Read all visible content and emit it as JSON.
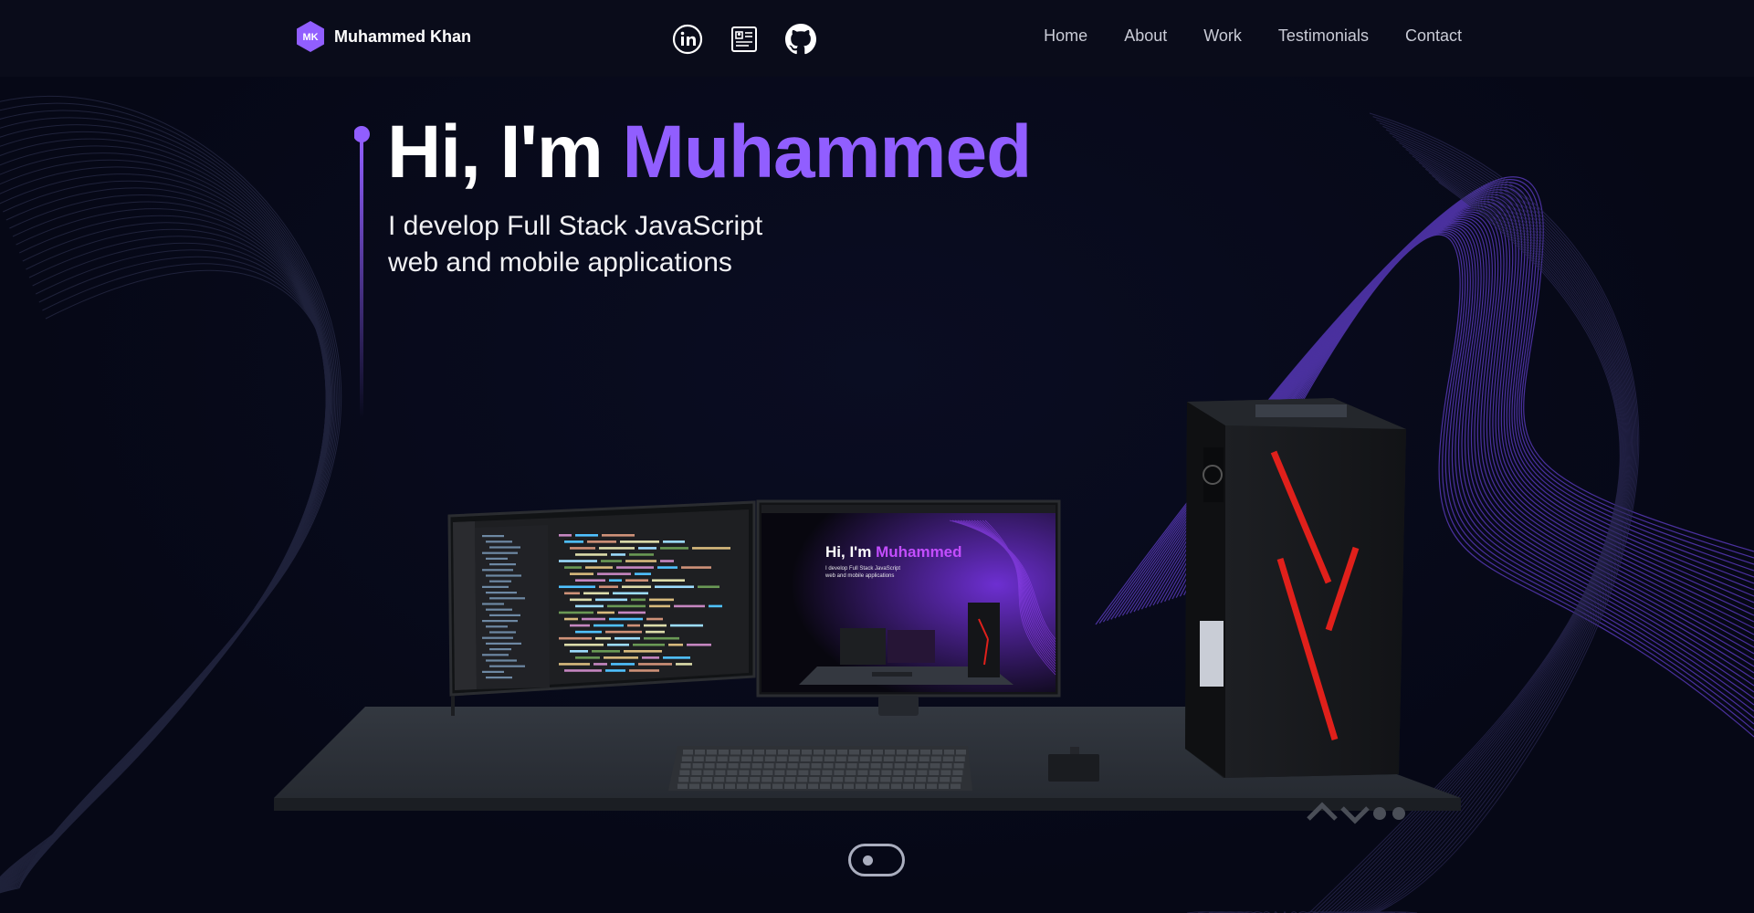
{
  "header": {
    "brand_initials": "MK",
    "brand_name": "Muhammed Khan",
    "socials": [
      {
        "icon": "linkedin-icon"
      },
      {
        "icon": "resume-icon"
      },
      {
        "icon": "github-icon"
      }
    ],
    "nav": [
      "Home",
      "About",
      "Work",
      "Testimonials",
      "Contact"
    ]
  },
  "hero": {
    "greeting": "Hi, I'm ",
    "name": "Muhammed",
    "subtitle_line1": "I develop Full Stack JavaScript",
    "subtitle_line2": "web and mobile applications"
  },
  "scene": {
    "mini_screen": {
      "greeting": "Hi, I'm ",
      "name": "Muhammed",
      "subtitle_line1": "I develop Full Stack JavaScript",
      "subtitle_line2": "web and mobile applications"
    }
  },
  "colors": {
    "accent": "#915eff",
    "background": "#060816",
    "header": "#0a0c1a",
    "desk": "#2b2f36",
    "case_stripe": "#e0201b"
  }
}
